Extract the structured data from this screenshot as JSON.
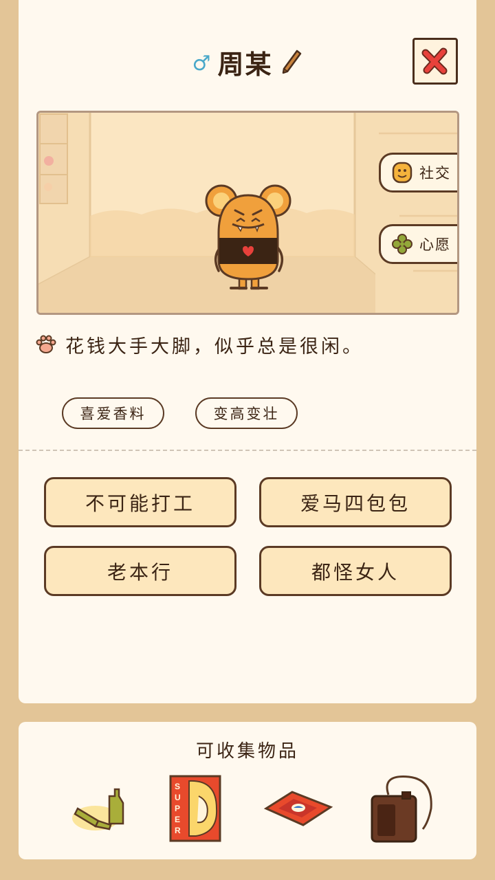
{
  "header": {
    "gender_icon": "male-symbol",
    "name": "周某",
    "edit_icon": "pencil-icon",
    "close_icon": "close-x-icon"
  },
  "scene": {
    "social_label": "社交",
    "wish_label": "心愿"
  },
  "description": {
    "icon": "paw-icon",
    "text": "花钱大手大脚，似乎总是很闲。"
  },
  "tags": [
    "喜爱香料",
    "变高变壮"
  ],
  "actions": [
    "不可能打工",
    "爱马四包包",
    "老本行",
    "都怪女人"
  ],
  "collectibles": {
    "title": "可收集物品",
    "items": [
      "bottles-icon",
      "super-poster-icon",
      "rug-icon",
      "bag-icon"
    ]
  },
  "colors": {
    "background": "#e3c597",
    "card": "#fff9ef",
    "button_fill": "#fde7bd",
    "outline": "#5b3a24",
    "close_red": "#e8413b",
    "male_blue": "#49a8c9"
  }
}
